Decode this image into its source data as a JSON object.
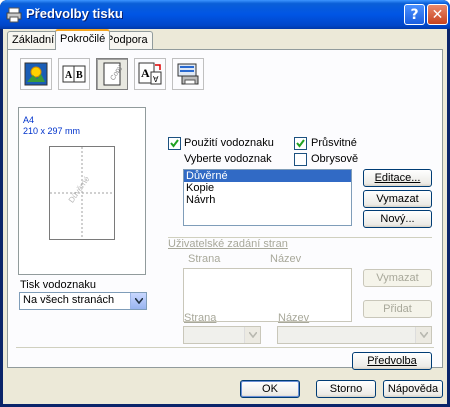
{
  "window": {
    "title": "Předvolby tisku",
    "help_btn": "?",
    "close_btn": "✕"
  },
  "tabs": [
    {
      "label": "Základní"
    },
    {
      "label": "Pokročilé"
    },
    {
      "label": "Podpora"
    }
  ],
  "toolbar": {
    "icons": [
      "print-quality-icon",
      "duplex-icon",
      "watermark-icon",
      "page-setting-icon",
      "device-options-icon"
    ],
    "active_index": 2
  },
  "preview": {
    "paper_size": "A4",
    "dimensions": "210 x 297 mm",
    "watermark_text": "Důvěrné"
  },
  "print_watermark": {
    "label": "Tisk vodoznaku",
    "value": "Na všech stranách"
  },
  "watermark": {
    "use_label": "Použití vodoznaku",
    "use_checked": true,
    "select_label": "Vyberte vodoznak",
    "items": [
      "Důvěrné",
      "Kopie",
      "Návrh"
    ],
    "selected_index": 0,
    "transparent_label": "Průsvitné",
    "transparent_checked": true,
    "outline_label": "Obrysově",
    "outline_checked": false,
    "edit_btn": "Editace...",
    "delete_btn": "Vymazat",
    "new_btn": "Nový..."
  },
  "custom_pages": {
    "group_label": "Uživatelské zadání stran",
    "col_page": "Strana",
    "col_title": "Název",
    "delete_btn": "Vymazat",
    "add_btn": "Přidat",
    "page_label": "Strana",
    "title_label": "Název",
    "page_value": "",
    "title_value": ""
  },
  "footer": {
    "defaults_btn": "Předvolba",
    "ok_btn": "OK",
    "cancel_btn": "Storno",
    "help_btn": "Nápověda"
  }
}
